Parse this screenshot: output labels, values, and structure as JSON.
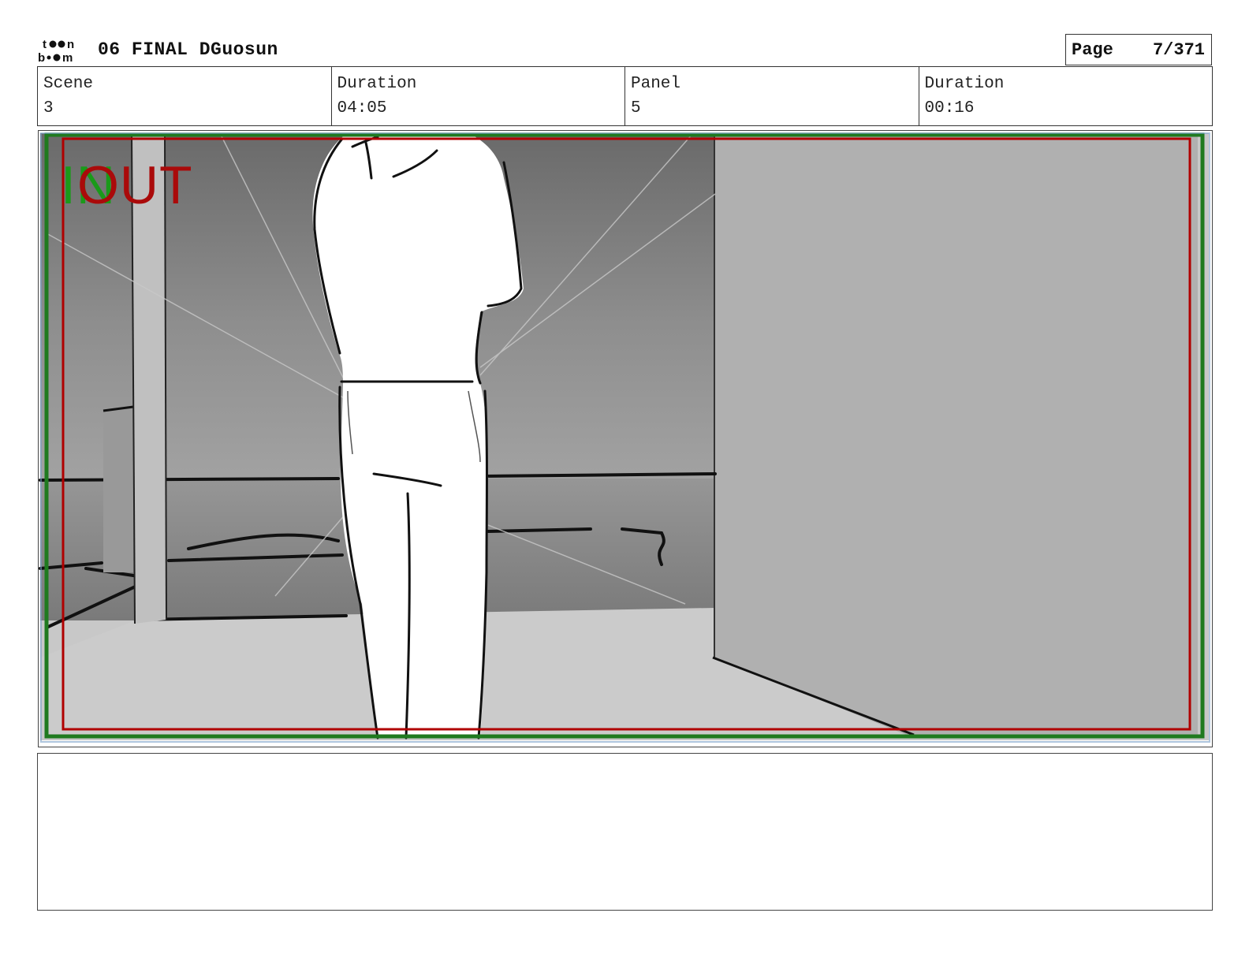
{
  "header": {
    "logo_label": "toon boom",
    "title": "06 FINAL DGuosun",
    "page_label": "Page",
    "page_value": "7/371"
  },
  "info": {
    "scene_label": "Scene",
    "scene_value": "3",
    "scene_duration_label": "Duration",
    "scene_duration_value": "04:05",
    "panel_label": "Panel",
    "panel_value": "5",
    "panel_duration_label": "Duration",
    "panel_duration_value": "00:16"
  },
  "panel_frame": {
    "in_label": "IN",
    "out_label": "OUT",
    "in_color": "#1a8a1a",
    "out_color": "#b00000"
  },
  "notes": {
    "text": ""
  }
}
